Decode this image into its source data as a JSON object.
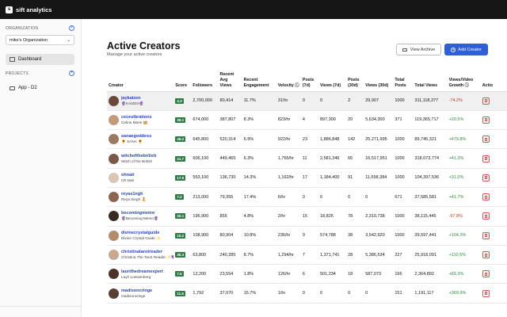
{
  "app": {
    "logo_char": "s",
    "brand": "sift analytics"
  },
  "sidebar": {
    "org_heading": "ORGANIZATION",
    "org_value": "mike's Organization",
    "nav_dashboard": "Dashboard",
    "projects_heading": "PROJECTS",
    "project_item": "App - D2"
  },
  "page": {
    "title": "Active Creators",
    "subtitle": "Manage your active creators",
    "view_archive": "View Archive",
    "add_creator": "Add Creator"
  },
  "table": {
    "headers": {
      "creator": "Creator",
      "score": "Score",
      "followers": "Followers",
      "recent_avg_views": "Recent Avg Views",
      "recent_engagement": "Recent Engagement",
      "velocity": "Velocity ⓘ",
      "posts_7d": "Posts (7d)",
      "views_7d": "Views (7d)",
      "posts_30d": "Posts (30d)",
      "views_30d": "Views (30d)",
      "total_posts": "Total Posts",
      "total_views": "Total Views",
      "growth": "Views/Video Growth ⓘ",
      "actions": "Actio"
    },
    "rows": [
      {
        "handle": "jaykaizen",
        "sub": "🔮KAIZEN🔮",
        "score": "4.3",
        "followers": "2,700,000",
        "avg_views": "80,414",
        "engagement": "11.7%",
        "velocity": "31/hr",
        "posts_7d": "0",
        "views_7d": "0",
        "posts_30d": "2",
        "views_30d": "29,907",
        "total_posts": "1000",
        "total_views": "311,118,377",
        "growth": "-74.2%",
        "growth_dir": "neg",
        "avatar_color": "#6b4a3a"
      },
      {
        "handle": "cecevibrations",
        "sub": "Celina Marie 🧺",
        "score": "39.1",
        "followers": "674,000",
        "avg_views": "387,807",
        "engagement": "8.3%",
        "velocity": "823/hr",
        "posts_7d": "4",
        "views_7d": "897,300",
        "posts_30d": "20",
        "views_30d": "5,634,300",
        "total_posts": "371",
        "total_views": "119,365,717",
        "growth": "+20.5%",
        "growth_dir": "pos",
        "avatar_color": "#c49a7a"
      },
      {
        "handle": "sanaegoddess",
        "sub": "🌻 SANA 🌻",
        "score": "49.2",
        "followers": "645,800",
        "avg_views": "520,314",
        "engagement": "6.9%",
        "velocity": "922/hr",
        "posts_7d": "23",
        "views_7d": "1,886,848",
        "posts_30d": "142",
        "views_30d": "25,271,995",
        "total_posts": "1000",
        "total_views": "89,745,321",
        "growth": "+479.8%",
        "growth_dir": "pos",
        "avatar_color": "#9a7b62"
      },
      {
        "handle": "witchofthebritish",
        "sub": "Witch of the British",
        "score": "21.7",
        "followers": "606,100",
        "avg_views": "449,465",
        "engagement": "6.3%",
        "velocity": "1,765/hr",
        "posts_7d": "11",
        "views_7d": "2,581,346",
        "posts_30d": "66",
        "views_30d": "16,517,951",
        "total_posts": "1000",
        "total_views": "318,073,774",
        "growth": "+41.3%",
        "growth_dir": "pos",
        "avatar_color": "#7a5a46"
      },
      {
        "handle": "ohnati",
        "sub": "Oh Nati",
        "score": "17.9",
        "followers": "553,100",
        "avg_views": "136,730",
        "engagement": "14.3%",
        "velocity": "1,162/hr",
        "posts_7d": "17",
        "views_7d": "1,184,400",
        "posts_30d": "91",
        "views_30d": "11,558,384",
        "total_posts": "1000",
        "total_views": "104,397,536",
        "growth": "+31.0%",
        "growth_dir": "pos",
        "avatar_color": "#d8c6b6"
      },
      {
        "handle": "reyas1ngh",
        "sub": "Reya Singh 🧘",
        "score": "7.2",
        "followers": "213,000",
        "avg_views": "79,355",
        "engagement": "17.4%",
        "velocity": "6/hr",
        "posts_7d": "0",
        "views_7d": "0",
        "posts_30d": "0",
        "views_30d": "0",
        "total_posts": "671",
        "total_views": "37,585,581",
        "growth": "+41.7%",
        "growth_dir": "pos",
        "avatar_color": "#8d6450"
      },
      {
        "handle": "becomingmemo",
        "sub": "🔮Becoming Memo🔮",
        "score": "20.1",
        "followers": "196,900",
        "avg_views": "855",
        "engagement": "4.8%",
        "velocity": "2/hr",
        "posts_7d": "15",
        "views_7d": "18,826",
        "posts_30d": "78",
        "views_30d": "2,310,738",
        "total_posts": "1000",
        "total_views": "38,115,445",
        "growth": "-97.8%",
        "growth_dir": "neg",
        "avatar_color": "#3a2a22"
      },
      {
        "handle": "divinecrystalguide",
        "sub": "Divine Crystal Guide ✨",
        "score": "15.2",
        "followers": "108,900",
        "avg_views": "80,904",
        "engagement": "10.8%",
        "velocity": "236/hr",
        "posts_7d": "9",
        "views_7d": "574,788",
        "posts_30d": "38",
        "views_30d": "3,542,920",
        "total_posts": "1000",
        "total_views": "39,597,441",
        "growth": "+104.3%",
        "growth_dir": "pos",
        "avatar_color": "#b38a6a"
      },
      {
        "handle": "christinatarotreader",
        "sub": "Christina The Tarot Reader ✨💜",
        "score": "35.3",
        "followers": "63,800",
        "avg_views": "240,285",
        "engagement": "8.7%",
        "velocity": "1,294/hr",
        "posts_7d": "7",
        "views_7d": "1,371,741",
        "posts_30d": "28",
        "views_30d": "5,386,534",
        "total_posts": "227",
        "total_views": "25,918,091",
        "growth": "+110.5%",
        "growth_dir": "pos",
        "avatar_color": "#c9a98e"
      },
      {
        "handle": "laurithedreamexpert",
        "sub": "Layri Loewenberg",
        "score": "7.5",
        "followers": "12,200",
        "avg_views": "23,554",
        "engagement": "1.8%",
        "velocity": "126/hr",
        "posts_7d": "6",
        "views_7d": "501,234",
        "posts_30d": "18",
        "views_30d": "587,073",
        "total_posts": "166",
        "total_views": "2,364,892",
        "growth": "+65.3%",
        "growth_dir": "pos",
        "avatar_color": "#4a3328"
      },
      {
        "handle": "madisoncringe",
        "sub": "madisoncringe",
        "score": "11.6",
        "followers": "1,792",
        "avg_views": "37,070",
        "engagement": "15.7%",
        "velocity": "1/hr",
        "posts_7d": "0",
        "views_7d": "0",
        "posts_30d": "0",
        "views_30d": "0",
        "total_posts": "151",
        "total_views": "1,191,117",
        "growth": "+369.9%",
        "growth_dir": "pos",
        "avatar_color": "#5a4034"
      }
    ]
  }
}
